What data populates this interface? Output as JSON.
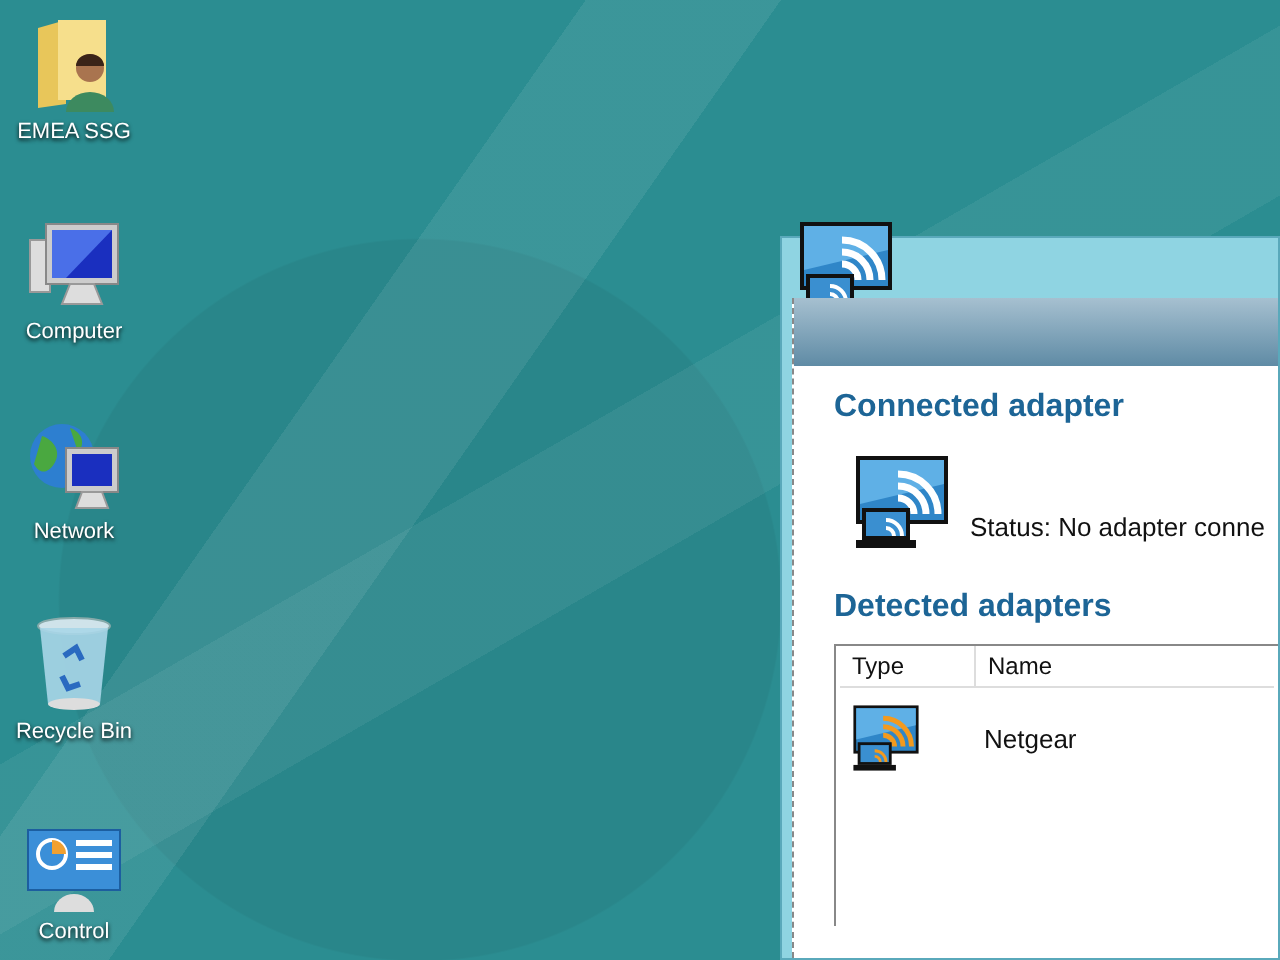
{
  "desktop_icons": [
    {
      "label": "EMEA SSG",
      "kind": "folder"
    },
    {
      "label": "Computer",
      "kind": "computer"
    },
    {
      "label": "Network",
      "kind": "network"
    },
    {
      "label": "Recycle Bin",
      "kind": "recycle"
    },
    {
      "label": "Control",
      "kind": "control"
    }
  ],
  "window": {
    "connected": {
      "heading": "Connected adapter",
      "status": "Status: No adapter conne"
    },
    "detected": {
      "heading": "Detected adapters",
      "columns": [
        "Type",
        "Name"
      ],
      "rows": [
        {
          "name": "Netgear"
        }
      ]
    }
  }
}
